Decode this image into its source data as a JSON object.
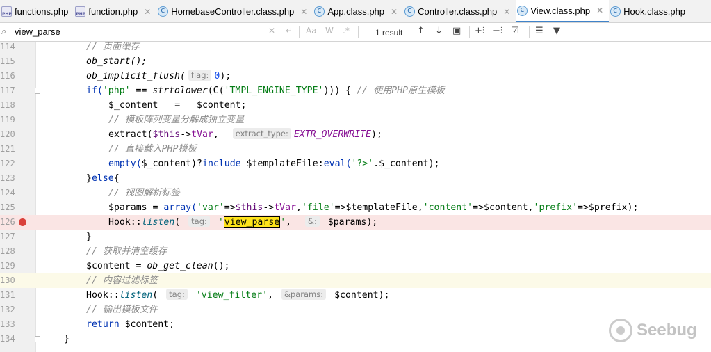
{
  "tabs": [
    {
      "label": "functions.php",
      "icon": "php-file-icon",
      "active": false,
      "close": false
    },
    {
      "label": "function.php",
      "icon": "php-file-icon",
      "active": false,
      "close": true
    },
    {
      "label": "HomebaseController.class.php",
      "icon": "class-file-icon",
      "active": false,
      "close": true
    },
    {
      "label": "App.class.php",
      "icon": "class-file-icon",
      "active": false,
      "close": true
    },
    {
      "label": "Controller.class.php",
      "icon": "class-file-icon",
      "active": false,
      "close": true
    },
    {
      "label": "View.class.php",
      "icon": "class-file-icon",
      "active": true,
      "close": true
    },
    {
      "label": "Hook.class.php",
      "icon": "class-file-icon",
      "active": false,
      "close": false
    }
  ],
  "search": {
    "query": "view_parse",
    "clear": "✕",
    "regex_opts": [
      "Aa",
      "W",
      ".*"
    ],
    "result": "1 result"
  },
  "lines": [
    {
      "n": "114"
    },
    {
      "n": "115"
    },
    {
      "n": "116"
    },
    {
      "n": "117"
    },
    {
      "n": "118"
    },
    {
      "n": "119"
    },
    {
      "n": "120"
    },
    {
      "n": "121"
    },
    {
      "n": "122"
    },
    {
      "n": "123"
    },
    {
      "n": "124"
    },
    {
      "n": "125"
    },
    {
      "n": "126"
    },
    {
      "n": "127"
    },
    {
      "n": "128"
    },
    {
      "n": "129"
    },
    {
      "n": "130"
    },
    {
      "n": "131"
    },
    {
      "n": "132"
    },
    {
      "n": "133"
    },
    {
      "n": "134"
    }
  ],
  "code": {
    "l114": "// 页面缓存",
    "l115": "ob_start();",
    "l116a": "ob_implicit_flush(",
    "l116h": "flag:",
    "l116n": "0",
    "l116b": ");",
    "l117a": "if(",
    "l117s": "'php'",
    "l117b": " == ",
    "l117f": "strtolower",
    "l117c": "(C(",
    "l117s2": "'TMPL_ENGINE_TYPE'",
    "l117d": "))) { ",
    "l117cm": "// 使用PHP原生模板",
    "l118": "$_content   =   $content;",
    "l119": "// 模板阵列变量分解成独立变量",
    "l120a": "extract(",
    "l120v": "$this",
    "l120b": "->",
    "l120p": "tVar",
    "l120c": ",  ",
    "l120h": "extract_type:",
    "l120k": "EXTR_OVERWRITE",
    "l120d": ");",
    "l121": "// 直接载入PHP模板",
    "l122a": "empty(",
    "l122v": "$_content",
    "l122b": ")?",
    "l122k": "include ",
    "l122v2": "$templateFile",
    "l122c": ":",
    "l122k2": "eval(",
    "l122s": "'?>'",
    "l122d": ".$_content);",
    "l123a": "}",
    "l123k": "else",
    "l123b": "{",
    "l124": "// 视图解析标签",
    "l125a": "$params = ",
    "l125k": "array(",
    "l125s1": "'var'",
    "l125b": "=>",
    "l125v": "$this",
    "l125c": "->",
    "l125p": "tVar",
    "l125d": ",",
    "l125s2": "'file'",
    "l125e": "=>",
    "l125v2": "$templateFile",
    "l125f": ",",
    "l125s3": "'content'",
    "l125g": "=>",
    "l125v3": "$content",
    "l125h": ",",
    "l125s4": "'prefix'",
    "l125i": "=>",
    "l125v4": "$prefix",
    "l125j": ");",
    "l126a": "Hook::",
    "l126m": "listen",
    "l126b": "( ",
    "l126h": "tag:",
    "l126q1": " '",
    "l126match": "view_parse",
    "l126q2": "'",
    ", ": ", ",
    "l126c": ",  ",
    "l126h2": "&:",
    "l126v": " $params",
    "l126d": ");",
    "l127": "}",
    "l128": "// 获取并清空缓存",
    "l129a": "$content = ",
    "l129f": "ob_get_clean",
    "l129b": "();",
    "l130": "// 内容过滤标签",
    "l131a": "Hook::",
    "l131m": "listen",
    "l131b": "( ",
    "l131h": "tag:",
    "l131s": " 'view_filter'",
    "l131c": ", ",
    "l131h2": "&params:",
    "l131v": " $content",
    "l131d": ");",
    "l132": "// 输出模板文件",
    "l133a": "return ",
    "l133v": "$content",
    ";": ";",
    "l134": "}"
  },
  "watermark": "Seebug"
}
